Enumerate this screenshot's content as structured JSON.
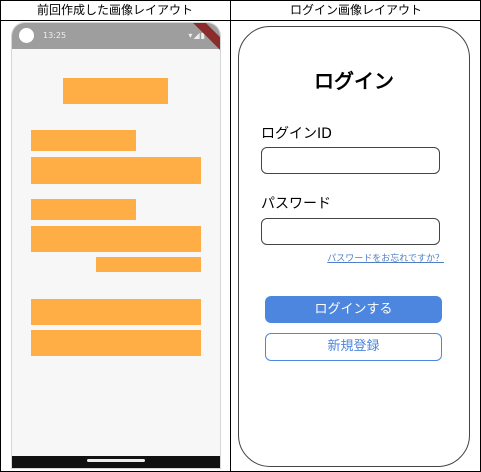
{
  "headers": {
    "left": "前回作成した画像レイアウト",
    "right": "ログイン画像レイアウト"
  },
  "phone": {
    "status_time": "13:25",
    "status_icons": "▾◢▮",
    "block_color": "#ffad45",
    "placeholder_block_count": 8
  },
  "login": {
    "title": "ログイン",
    "login_id_label": "ログインID",
    "password_label": "パスワード",
    "forgot_link": "パスワードをお忘れですか？",
    "login_button": "ログインする",
    "register_button": "新規登録",
    "accent_color": "#4d86de"
  }
}
